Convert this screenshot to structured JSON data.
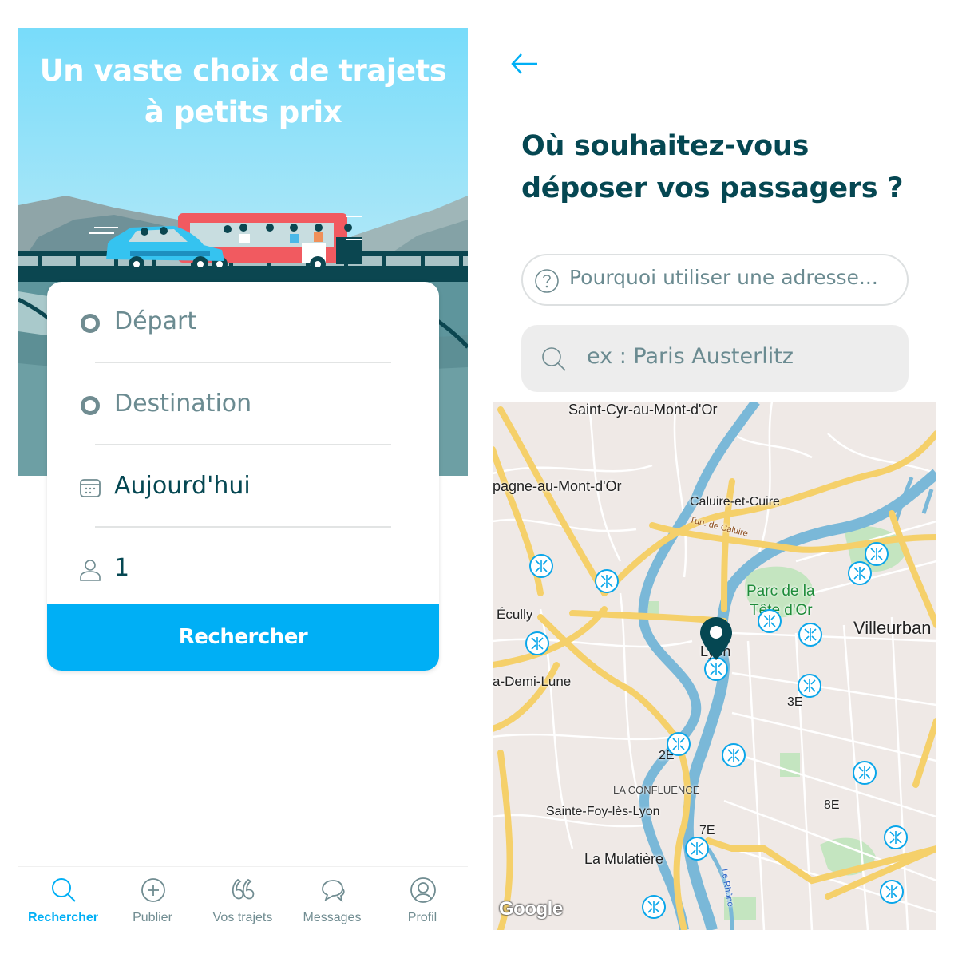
{
  "left_screen": {
    "hero": {
      "title_line1": "Un vaste choix de trajets",
      "title_line2": "à petits prix"
    },
    "form": {
      "departure": {
        "placeholder": "Départ",
        "icon": "circle-outline-icon"
      },
      "destination": {
        "placeholder": "Destination",
        "icon": "circle-outline-icon"
      },
      "date": {
        "value": "Aujourd'hui",
        "icon": "calendar-icon"
      },
      "passengers": {
        "value": "1",
        "icon": "person-icon"
      },
      "search_button": "Rechercher"
    },
    "bottom_nav": {
      "items": [
        {
          "label": "Rechercher",
          "icon": "search-icon",
          "active": true
        },
        {
          "label": "Publier",
          "icon": "plus-circle-icon",
          "active": false
        },
        {
          "label": "Vos trajets",
          "icon": "quote-icon",
          "active": false
        },
        {
          "label": "Messages",
          "icon": "chat-bubbles-icon",
          "active": false
        },
        {
          "label": "Profil",
          "icon": "profile-circle-icon",
          "active": false
        }
      ]
    }
  },
  "right_screen": {
    "back_icon": "arrow-left-icon",
    "title_line1": "Où souhaitez-vous",
    "title_line2": "déposer vos passagers ?",
    "help_pill": {
      "icon": "question-circle-icon",
      "label": "Pourquoi utiliser une adresse..."
    },
    "address_input": {
      "icon": "search-icon",
      "placeholder": "ex : Paris Austerlitz",
      "value": ""
    },
    "map": {
      "labels": {
        "saint_cyr": "Saint-Cyr-au-Mont-d'Or",
        "champagne": "pagne-au-Mont-d'Or",
        "caluire": "Caluire-et-Cuire",
        "tunnel": "Tun. de Caluire",
        "parc1": "Parc de la",
        "parc2": "Tête d'Or",
        "ecully": "Écully",
        "villeurbanne": "Villeurban",
        "lyon": "Lyon",
        "demi_lune": "a-Demi-Lune",
        "e3": "3E",
        "e2": "2E",
        "confluence": "LA CONFLUENCE",
        "sainte_foy": "Sainte-Foy-lès-Lyon",
        "e8": "8E",
        "e7": "7E",
        "mulatiere": "La Mulatière",
        "rhone": "Le Rhône"
      },
      "meeting_point_icon": "meeting-point-icon",
      "pin_icon": "map-pin-icon",
      "attribution": "Google"
    }
  },
  "colors": {
    "brand_blue": "#00aff5",
    "dark_teal": "#054752",
    "muted_text": "#708c91",
    "map_water": "#7ab8d8",
    "map_highway": "#f5d06a",
    "map_park": "#c4e5c0"
  }
}
